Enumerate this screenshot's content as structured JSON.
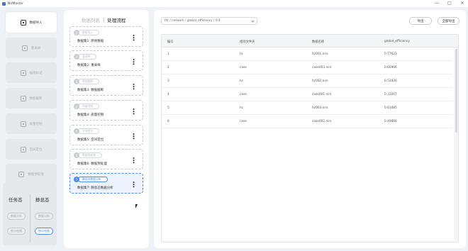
{
  "window": {
    "title": "NIrMaster",
    "controls": [
      "—",
      "□",
      "✕"
    ]
  },
  "sidebar": {
    "items": [
      {
        "label": "数据导入",
        "icon": "import-icon",
        "active": true
      },
      {
        "label": "重采样",
        "icon": "resample-icon",
        "active": false
      },
      {
        "label": "插值标记",
        "icon": "marker-icon",
        "active": false
      },
      {
        "label": "数据截断",
        "icon": "truncate-icon",
        "active": false
      },
      {
        "label": "质量控制",
        "icon": "quality-icon",
        "active": false
      },
      {
        "label": "空间定位",
        "icon": "location-icon",
        "active": false
      },
      {
        "label": "数据预处理",
        "icon": "preprocess-icon",
        "active": false
      }
    ],
    "modes": {
      "task_label": "任务态",
      "static_label": "静息态",
      "task_buttons": [
        "数据分析",
        "统计绘图"
      ],
      "static_buttons": [
        "数据分析",
        "统计绘图"
      ],
      "active": "统计绘图"
    }
  },
  "flow": {
    "tab_list": "数据列表",
    "separator": "|",
    "tab_flow": "处理流程",
    "steps": [
      {
        "num": "1",
        "tag": "数据导入",
        "desc": "数据集1: 原始数据",
        "active": false
      },
      {
        "num": "2",
        "tag": "重采样",
        "desc": "数据集2: 重采样",
        "active": false
      },
      {
        "num": "3",
        "tag": "数据截断",
        "desc": "数据集3: 数据截断",
        "active": false
      },
      {
        "num": "4",
        "tag": "质量控制",
        "desc": "数据集4: 质量控制",
        "active": false
      },
      {
        "num": "5",
        "tag": "空间定位",
        "desc": "数据集5: 空间定位",
        "active": false
      },
      {
        "num": "6",
        "tag": "数据预处理",
        "desc": "数据集6: 数据预处理",
        "active": false
      },
      {
        "num": "7",
        "tag": "静息态数据分析",
        "desc": "数据集7: 静息态数据分析",
        "active": true
      }
    ]
  },
  "main": {
    "path": "fdr / network / global_efficiency / 0.4",
    "export_label": "导出",
    "export_all_label": "全部导出",
    "columns": [
      "编号",
      "组别文件夹",
      "数据名称",
      "global_efficiency"
    ],
    "rows": [
      [
        "1",
        "hc",
        "hc001.nirs",
        "0.77623"
      ],
      [
        "2",
        "case",
        "case003.nirs",
        "0.60906"
      ],
      [
        "3",
        "hc",
        "hc002.nirs",
        "0.53426"
      ],
      [
        "4",
        "case",
        "case001.nirs",
        "0.31047"
      ],
      [
        "5",
        "hc",
        "hc003.nirs",
        "0.61085"
      ],
      [
        "6",
        "case",
        "case002.nirs",
        "0.49868"
      ]
    ]
  }
}
